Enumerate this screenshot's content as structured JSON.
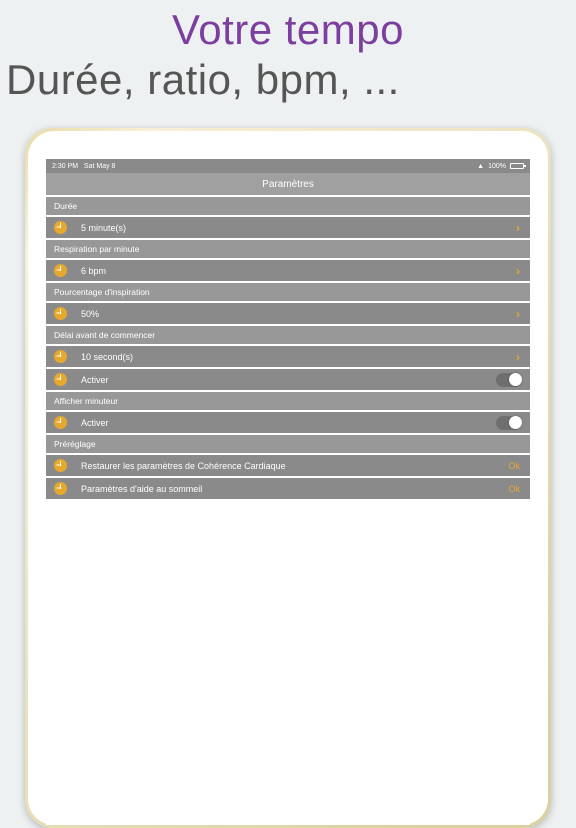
{
  "headline": "Votre tempo",
  "subhead": "Durée, ratio, bpm, ...",
  "statusbar": {
    "time": "2:30 PM",
    "date": "Sat May 8",
    "battery": "100%"
  },
  "navbar": {
    "title": "Paramètres"
  },
  "sections": {
    "duree": {
      "header": "Durée",
      "value": "5 minute(s)"
    },
    "respiration": {
      "header": "Respiration par minute",
      "value": "6 bpm"
    },
    "inspiration": {
      "header": "Pourcentage d'inspiration",
      "value": "50%"
    },
    "delai": {
      "header": "Délai avant de commencer",
      "value": "10 second(s)",
      "toggle_label": "Activer"
    },
    "minuteur": {
      "header": "Afficher minuteur",
      "toggle_label": "Activer"
    },
    "prereglage": {
      "header": "Préréglage",
      "row1": "Restaurer les paramètres de Cohérence Cardiaque",
      "row1_action": "Ok",
      "row2": "Paramètres d'aide au sommeil",
      "row2_action": "Ok"
    }
  }
}
